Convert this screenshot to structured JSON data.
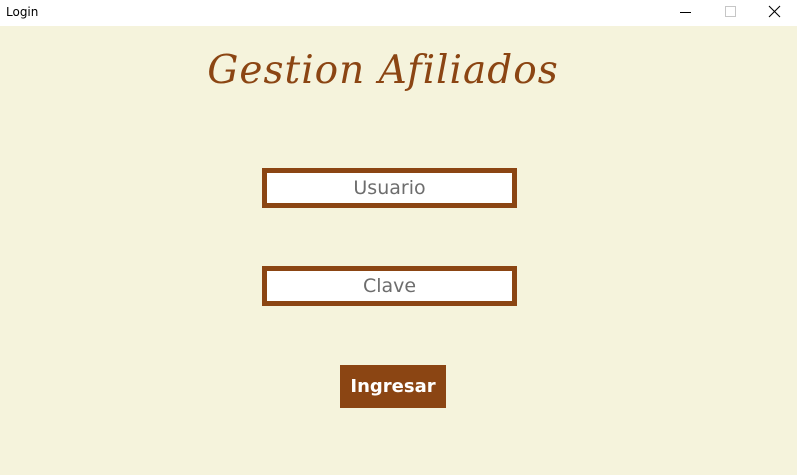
{
  "window": {
    "title": "Login",
    "controls": [
      "minimize-icon",
      "maximize-icon",
      "close-icon"
    ]
  },
  "app": {
    "title": "Gestion Afiliados"
  },
  "form": {
    "username": {
      "placeholder": "Usuario",
      "value": ""
    },
    "password": {
      "placeholder": "Clave",
      "value": ""
    },
    "submit_label": "Ingresar"
  },
  "colors": {
    "background": "#f5f3dc",
    "accent": "#8b4513",
    "field_background": "#ffffff",
    "placeholder_text": "#6d6d6d",
    "button_text": "#ffffff"
  }
}
